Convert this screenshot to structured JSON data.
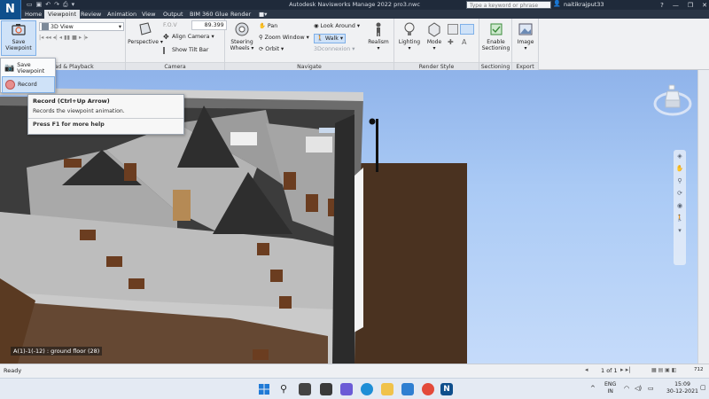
{
  "titlebar": {
    "app_letter": "N",
    "title": "Autodesk Navisworks Manage 2022    pro3.nwc",
    "search_placeholder": "Type a keyword or phrase",
    "username": "naitikrajput33",
    "minimize": "—",
    "restore": "❐",
    "close": "✕"
  },
  "tabs": [
    "Home",
    "Viewpoint",
    "Review",
    "Animation",
    "View",
    "Output",
    "BIM 360 Glue",
    "Render"
  ],
  "active_tab": "Viewpoint",
  "ribbon": {
    "save_viewpoint": {
      "line1": "Save",
      "line2": "Viewpoint"
    },
    "view_select": "3D View",
    "panel_save_load": "Save, Load & Playback",
    "camera": {
      "perspective": "Perspective",
      "align_camera": "Align Camera",
      "show_tilt_bar": "Show Tilt Bar",
      "fov_label": "F.O.V",
      "fov_value": "89.399",
      "panel_title": "Camera"
    },
    "navigate": {
      "steering_wheels_1": "Steering",
      "steering_wheels_2": "Wheels",
      "pan": "Pan",
      "zoom_window": "Zoom Window",
      "orbit": "Orbit",
      "look_around": "Look Around",
      "walk": "Walk",
      "connexion": "3Dconnexion",
      "realism": "Realism",
      "panel_title": "Navigate"
    },
    "render_style": {
      "lighting": "Lighting",
      "mode": "Mode",
      "panel_title": "Render Style"
    },
    "sectioning": {
      "line1": "Enable",
      "line2": "Sectioning",
      "panel_title": "Sectioning"
    },
    "export": {
      "image": "Image",
      "panel_title": "Export"
    }
  },
  "save_dropdown": {
    "save_viewpoint": "Save Viewpoint",
    "record": "Record"
  },
  "tooltip": {
    "title": "Record (Ctrl+Up Arrow)",
    "description": "Records the viewpoint animation.",
    "help": "Press F1 for more help"
  },
  "viewport": {
    "label": "A(1)-1(-12) : ground floor (28)"
  },
  "statusbar": {
    "ready": "Ready",
    "pages": "1 of 1",
    "memory": "712"
  },
  "taskbar": {
    "lang1": "ENG",
    "lang2": "IN",
    "time": "15:09",
    "date": "30-12-2021"
  },
  "colors": {
    "titlebar": "#1f2a3a",
    "ribbon": "#f0f1f3",
    "sky": "#aacaf5",
    "brown_floor": "#4a3220",
    "wall_grey": "#b8b8b8"
  }
}
